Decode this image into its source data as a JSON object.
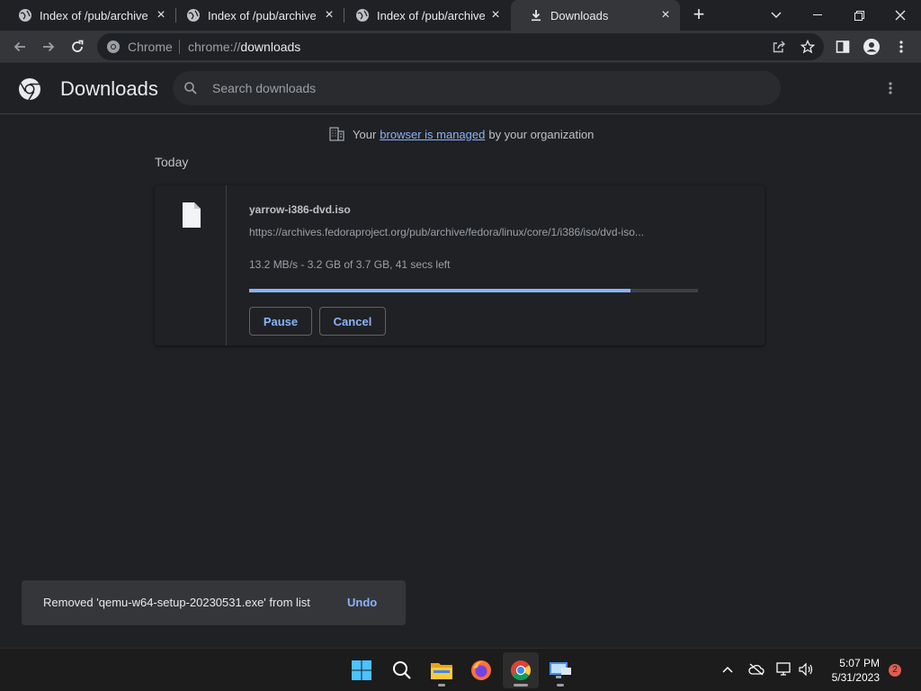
{
  "tabs": [
    {
      "label": "Index of /pub/archive/f",
      "icon": "globe-icon",
      "close": "×"
    },
    {
      "label": "Index of /pub/archive/f",
      "icon": "globe-icon",
      "close": "×"
    },
    {
      "label": "Index of /pub/archive/f",
      "icon": "globe-icon",
      "close": "×"
    },
    {
      "label": "Downloads",
      "icon": "download-icon",
      "close": "×",
      "active": true
    }
  ],
  "toolbar": {
    "site_label": "Chrome",
    "url_scheme": "chrome://",
    "url_path": "downloads"
  },
  "header": {
    "title": "Downloads",
    "search_placeholder": "Search downloads"
  },
  "managed": {
    "prefix": "Your",
    "link": "browser is managed",
    "suffix": "by your organization"
  },
  "section_date": "Today",
  "download": {
    "filename": "yarrow-i386-dvd.iso",
    "url": "https://archives.fedoraproject.org/pub/archive/fedora/linux/core/1/i386/iso/dvd-iso...",
    "status": "13.2 MB/s - 3.2 GB of 3.7 GB, 41 secs left",
    "progress_fraction": 0.85,
    "pause_label": "Pause",
    "cancel_label": "Cancel"
  },
  "toast": {
    "message": "Removed 'qemu-w64-setup-20230531.exe' from list",
    "undo_label": "Undo"
  },
  "taskbar": {
    "time": "5:07 PM",
    "date": "5/31/2023",
    "notification_count": "2"
  },
  "colors": {
    "accent": "#8ab4f8",
    "background": "#202124",
    "toolbar": "#35363a"
  }
}
